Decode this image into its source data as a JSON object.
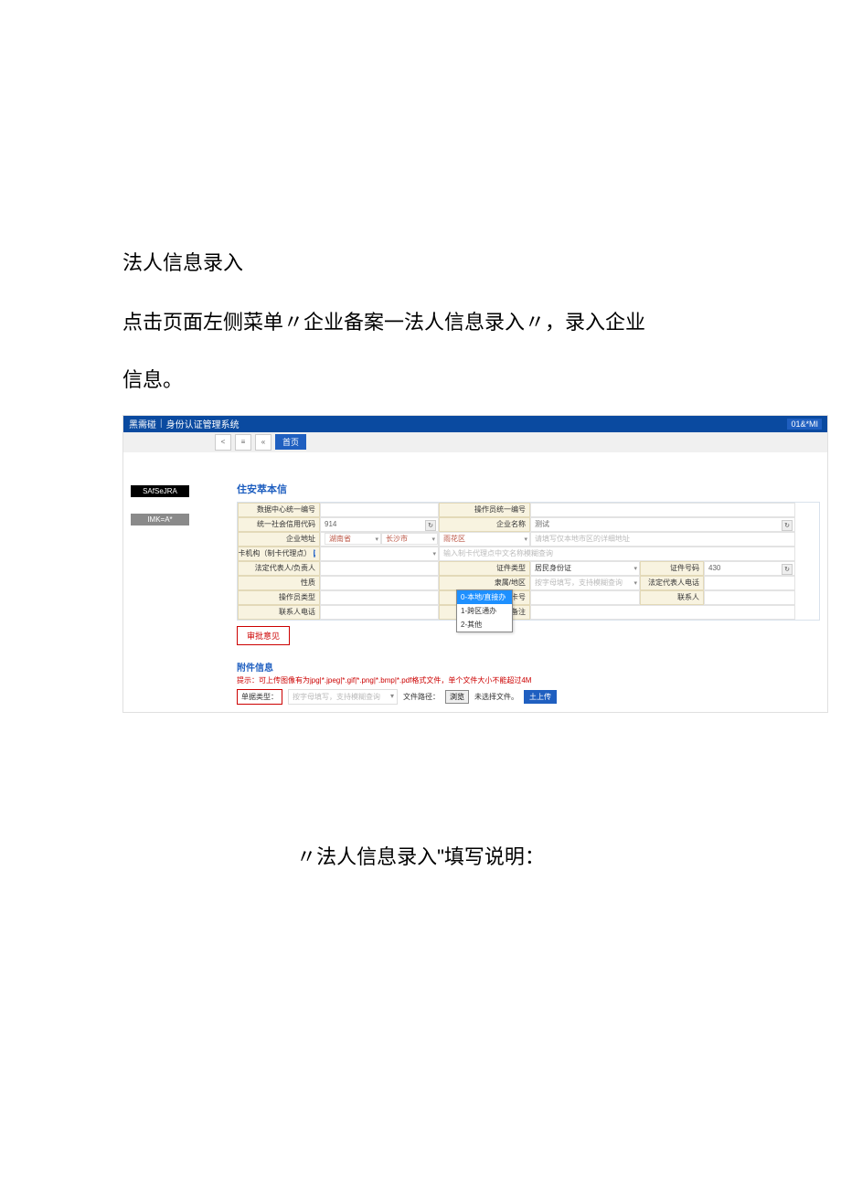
{
  "doc": {
    "title": "法人信息录入",
    "p1": "点击页面左侧菜单〃企业备案一法人信息录入〃，录入企业",
    "p2": "信息。",
    "caption": "〃法人信息录入\"填写说明："
  },
  "header": {
    "brand": "黑需碰",
    "systemName": "身份认证管理系统",
    "rightBadge": "01&*MI"
  },
  "tabs": {
    "prev": "<",
    "list": "≡",
    "refresh": "«",
    "active": "首页"
  },
  "sidebar": {
    "btn1": "SAfSeJRA",
    "btn2": "IMK=A*"
  },
  "form": {
    "sectionTitle": "住安萃本信",
    "rows": {
      "dataCenterId_lbl": "数据中心统一编号",
      "dataCenterId_val": "",
      "opSerial_lbl": "操作员统一编号",
      "opSerial_val": "",
      "socialCode_lbl": "统一社会信用代码",
      "socialCode_val": "914",
      "enterpriseName_lbl": "企业名称",
      "enterpriseName_val": "测试",
      "bizAddr_lbl": "企业地址",
      "prov": "湖南省",
      "city": "长沙市",
      "district": "雨花区",
      "addrHint": "请填写仅本地市区的详细地址",
      "issueOrg_lbl": "发卡机构（制卡代理点）",
      "issueOrg_hint": "输入制卡代理点中文名称模糊查询",
      "legal_lbl": "法定代表人/负责人",
      "idType_lbl": "证件类型",
      "idType_val": "居民身份证",
      "idNo_lbl": "证件号码",
      "idNo_val": "430",
      "nature_lbl": "性质",
      "region_lbl": "隶属/地区",
      "region_hint": "按字母填写，支持模糊查询",
      "legalPhone_lbl": "法定代表人电话",
      "opType_lbl": "操作员类型",
      "icCard_lbl": "IC卡号",
      "contact_lbl": "联系人",
      "contactPhone_lbl": "联系人电话",
      "remark_lbl": "备注"
    },
    "dropdown": {
      "opt0": "0-本地/直接办",
      "opt1": "1-跨区通办",
      "opt2": "2-其他"
    },
    "reviewBtn": "审批意见"
  },
  "attach": {
    "title": "附件信息",
    "tip": "提示：可上传图像有为jpg|*.jpeg|*.gif|*.png|*.bmp|*.pdf格式文件，单个文件大小不能超过4M",
    "typeLabel": "单据类型：",
    "typeHint": "按字母填写，支持模糊查询",
    "pathLabel": "文件路径：",
    "browse": "浏览",
    "noFile": "未选择文件。",
    "upload": "土上传"
  }
}
